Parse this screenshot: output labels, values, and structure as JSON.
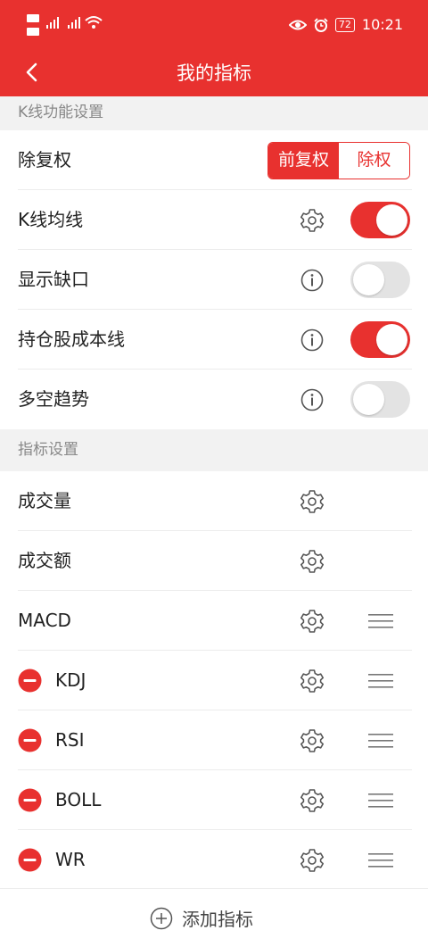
{
  "statusbar": {
    "battery": "72",
    "time": "10:21"
  },
  "header": {
    "title": "我的指标"
  },
  "kline_section": {
    "title": "K线功能设置",
    "adjust": {
      "label": "除复权",
      "options": [
        "前复权",
        "除权"
      ],
      "selected": "前复权"
    },
    "rows": [
      {
        "label": "K线均线",
        "icon": "gear-icon",
        "toggle": "on"
      },
      {
        "label": "显示缺口",
        "icon": "info-icon",
        "toggle": "off"
      },
      {
        "label": "持仓股成本线",
        "icon": "info-icon",
        "toggle": "on"
      },
      {
        "label": "多空趋势",
        "icon": "info-icon",
        "toggle": "off"
      }
    ]
  },
  "indicator_section": {
    "title": "指标设置",
    "items": [
      {
        "label": "成交量",
        "removable": false,
        "draggable": false
      },
      {
        "label": "成交额",
        "removable": false,
        "draggable": false
      },
      {
        "label": "MACD",
        "removable": false,
        "draggable": true
      },
      {
        "label": "KDJ",
        "removable": true,
        "draggable": true
      },
      {
        "label": "RSI",
        "removable": true,
        "draggable": true
      },
      {
        "label": "BOLL",
        "removable": true,
        "draggable": true
      },
      {
        "label": "WR",
        "removable": true,
        "draggable": true
      }
    ],
    "add_label": "添加指标"
  },
  "colors": {
    "accent": "#e8312f",
    "toggle_off": "#e3e3e3",
    "section_bg": "#f2f2f2"
  }
}
